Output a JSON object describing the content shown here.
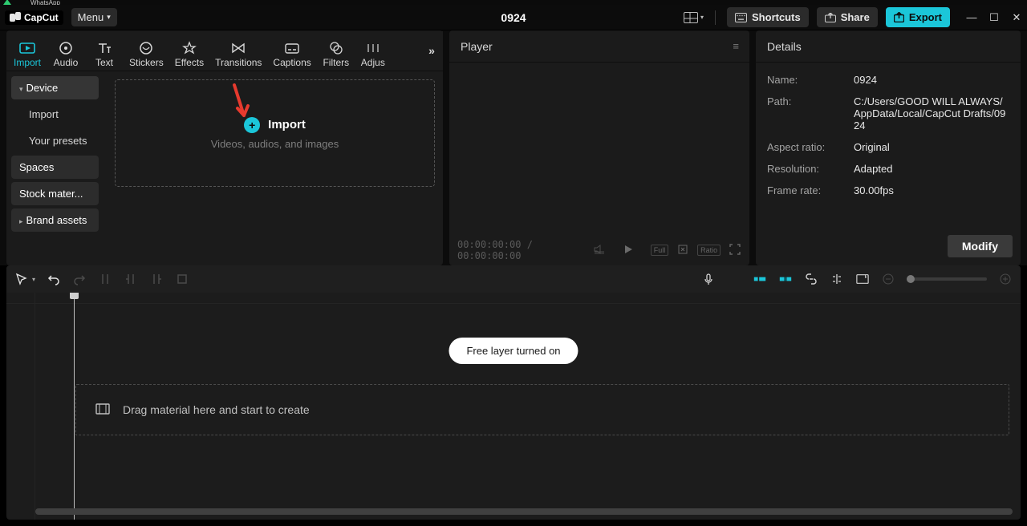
{
  "taskbar_fragment": "WhatsApp",
  "app_name": "CapCut",
  "menu_button": "Menu",
  "project_title": "0924",
  "titlebar": {
    "shortcuts": "Shortcuts",
    "share": "Share",
    "export": "Export"
  },
  "media_tabs": [
    "Import",
    "Audio",
    "Text",
    "Stickers",
    "Effects",
    "Transitions",
    "Captions",
    "Filters",
    "Adjus"
  ],
  "subnav": {
    "device": "Device",
    "import": "Import",
    "presets": "Your presets",
    "spaces": "Spaces",
    "stock": "Stock mater...",
    "brand": "Brand assets"
  },
  "import_card": {
    "title": "Import",
    "hint": "Videos, audios, and images"
  },
  "player": {
    "title": "Player",
    "time": "00:00:00:00 / 00:00:00:00",
    "full": "Full",
    "ratio": "Ratio"
  },
  "details": {
    "title": "Details",
    "name_label": "Name:",
    "name_value": "0924",
    "path_label": "Path:",
    "path_value": "C:/Users/GOOD WILL ALWAYS/AppData/Local/CapCut Drafts/0924",
    "aspect_label": "Aspect ratio:",
    "aspect_value": "Original",
    "resolution_label": "Resolution:",
    "resolution_value": "Adapted",
    "framerate_label": "Frame rate:",
    "framerate_value": "30.00fps",
    "modify": "Modify"
  },
  "toast": "Free layer turned on",
  "drop_hint": "Drag material here and start to create"
}
